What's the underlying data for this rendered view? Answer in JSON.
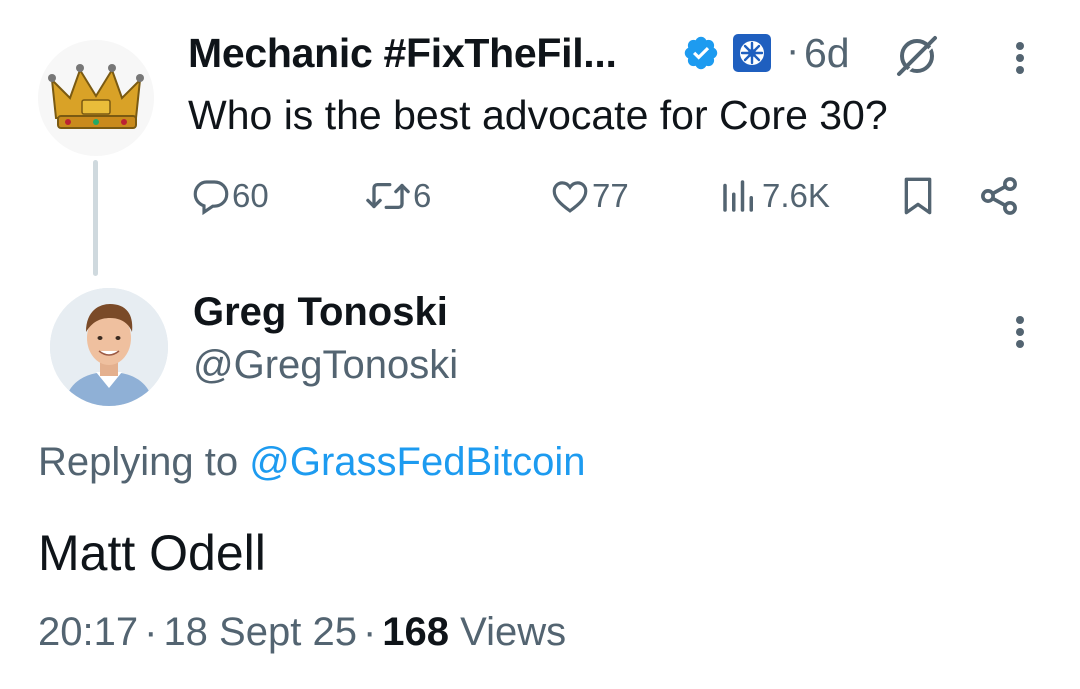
{
  "parent_tweet": {
    "display_name": "Mechanic #FixTheFil...",
    "age": "6d",
    "separator": "·",
    "text": "Who is the best advocate for Core 30?",
    "actions": {
      "reply_count": "60",
      "retweet_count": "6",
      "like_count": "77",
      "view_count": "7.6K"
    },
    "icons": [
      "crown-avatar",
      "verified-badge-icon",
      "affiliate-badge-icon",
      "grok-icon",
      "more-icon",
      "reply-icon",
      "retweet-icon",
      "like-icon",
      "views-icon",
      "bookmark-icon",
      "share-icon"
    ]
  },
  "reply_tweet": {
    "display_name": "Greg Tonoski",
    "handle": "@GregTonoski",
    "replying_prefix": "Replying to ",
    "replying_to": "@GrassFedBitcoin",
    "text": "Matt Odell",
    "time": "20:17",
    "date": "18 Sept 25",
    "separator": "·",
    "views_count": "168",
    "views_label": "Views"
  },
  "colors": {
    "text": "#0f1419",
    "secondary": "#536471",
    "link": "#1d9bf0",
    "verified": "#1d9bf0",
    "thread_line": "#cfd9de"
  }
}
